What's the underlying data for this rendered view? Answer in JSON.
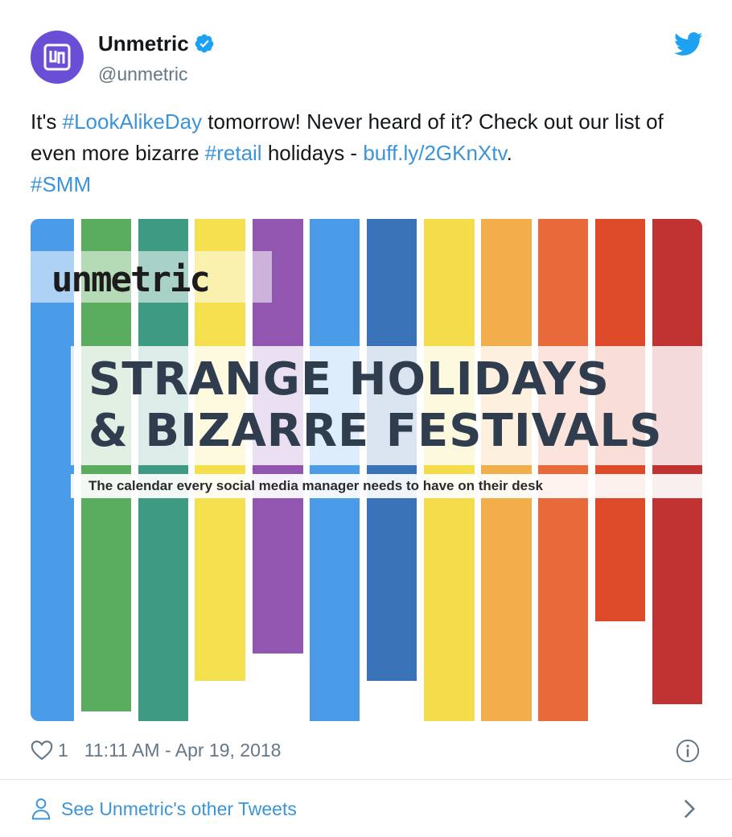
{
  "user": {
    "display_name": "Unmetric",
    "handle": "@unmetric",
    "verified": true,
    "avatar_icon": "unmetric-logo-icon",
    "avatar_color": "#6a4fd6"
  },
  "tweet": {
    "segments": [
      {
        "text": "It's ",
        "link": false
      },
      {
        "text": "#LookAlikeDay",
        "link": true
      },
      {
        "text": " tomorrow! Never heard of it? Check out our list of even more bizarre ",
        "link": false
      },
      {
        "text": "#retail",
        "link": true
      },
      {
        "text": " holidays - ",
        "link": false
      },
      {
        "text": "buff.ly/2GKnXtv",
        "link": true
      },
      {
        "text": ". ",
        "link": false
      },
      {
        "text": "#SMM",
        "link": true
      }
    ]
  },
  "media": {
    "brand": "unmetric",
    "title_line1": "STRANGE HOLIDAYS",
    "title_line2": "& BIZARRE FESTIVALS",
    "subtitle": "The calendar every social media manager needs to have on their desk",
    "bar_colors": [
      "#4a9be8",
      "#5aad5e",
      "#3f9a83",
      "#f4e04f",
      "#9157b0",
      "#4a9be8",
      "#3a72b8",
      "#f5dc4a",
      "#f2ae4a",
      "#e8693a",
      "#dd4a2a",
      "#c13333"
    ]
  },
  "footer": {
    "like_count": "1",
    "timestamp": "11:11 AM - Apr 19, 2018",
    "other_tweets_label": "See Unmetric's other Tweets"
  },
  "colors": {
    "link": "#3b94d9",
    "secondary_text": "#657786",
    "twitter_blue": "#1da1f2"
  }
}
